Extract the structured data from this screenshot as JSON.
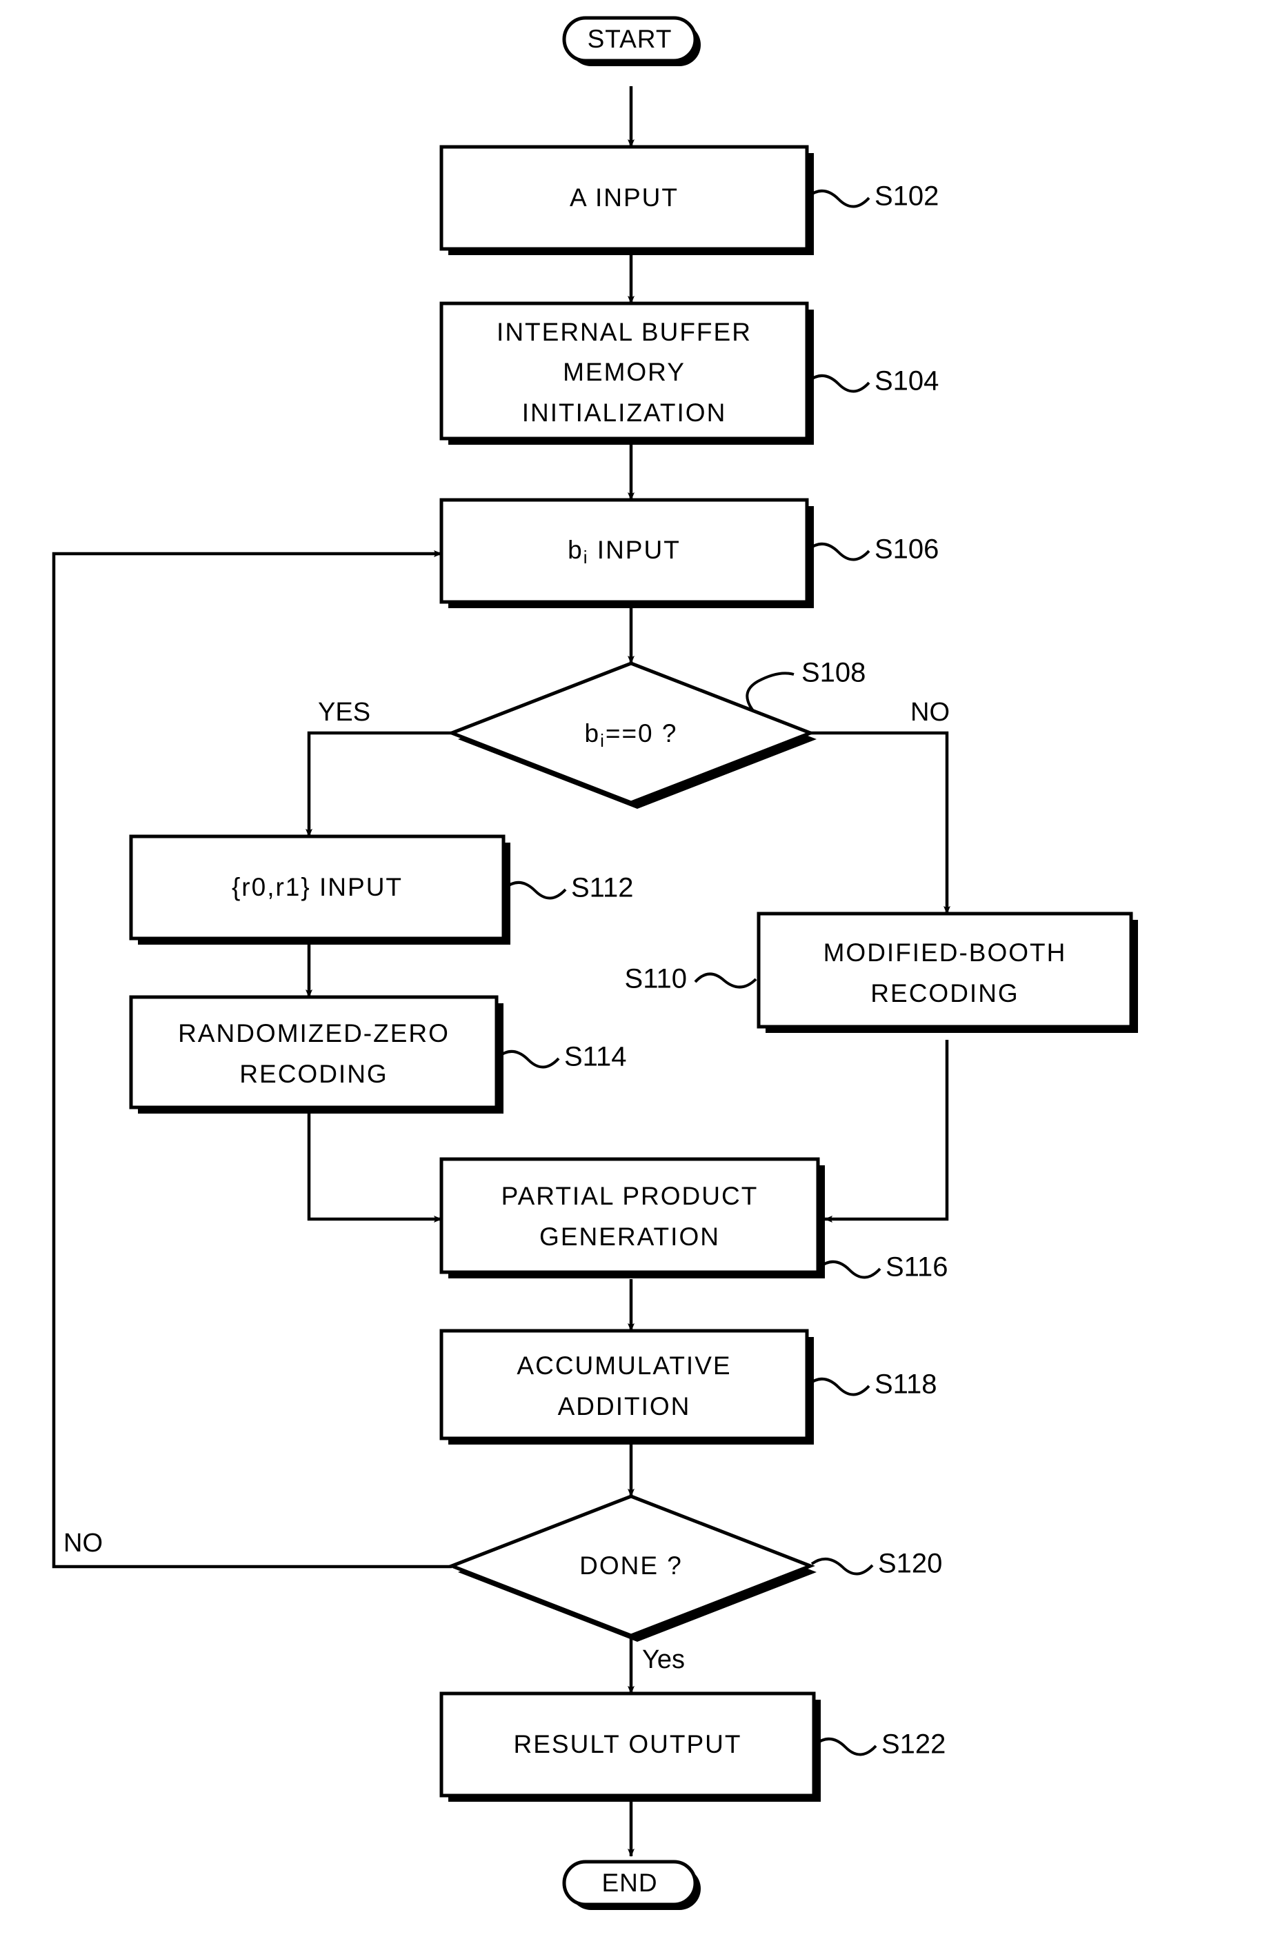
{
  "diagram": {
    "title": "Randomized-zero modified-booth multiplication flowchart",
    "terminators": {
      "start": "START",
      "end": "END"
    },
    "nodes": [
      {
        "id": "S102",
        "ref": "S102",
        "lines": [
          "A  INPUT"
        ],
        "shape": "process"
      },
      {
        "id": "S104",
        "ref": "S104",
        "lines": [
          "INTERNAL BUFFER",
          "MEMORY",
          "INITIALIZATION"
        ],
        "shape": "process"
      },
      {
        "id": "S106",
        "ref": "S106",
        "lines": [
          "bᵢ INPUT"
        ],
        "shape": "process"
      },
      {
        "id": "S108",
        "ref": "S108",
        "lines": [
          "bᵢ==0 ?"
        ],
        "shape": "decision"
      },
      {
        "id": "S110",
        "ref": "S110",
        "lines": [
          "MODIFIED-BOOTH",
          "RECODING"
        ],
        "shape": "process"
      },
      {
        "id": "S112",
        "ref": "S112",
        "lines": [
          "{r0,r1} INPUT"
        ],
        "shape": "process"
      },
      {
        "id": "S114",
        "ref": "S114",
        "lines": [
          "RANDOMIZED-ZERO",
          "RECODING"
        ],
        "shape": "process"
      },
      {
        "id": "S116",
        "ref": "S116",
        "lines": [
          "PARTIAL PRODUCT",
          "GENERATION"
        ],
        "shape": "process"
      },
      {
        "id": "S118",
        "ref": "S118",
        "lines": [
          "ACCUMULATIVE",
          "ADDITION"
        ],
        "shape": "process"
      },
      {
        "id": "S120",
        "ref": "S120",
        "lines": [
          "DONE ?"
        ],
        "shape": "decision"
      },
      {
        "id": "S122",
        "ref": "S122",
        "lines": [
          "RESULT OUTPUT"
        ],
        "shape": "process"
      }
    ],
    "edge_labels": {
      "s108_yes": "YES",
      "s108_no": "NO",
      "s120_no": "NO",
      "s120_yes": "Yes"
    },
    "refs": {
      "s102": "S102",
      "s104": "S104",
      "s106": "S106",
      "s108": "S108",
      "s110": "S110",
      "s112": "S112",
      "s114": "S114",
      "s116": "S116",
      "s118": "S118",
      "s120": "S120",
      "s122": "S122"
    },
    "text": {
      "s102_l1": "A  INPUT",
      "s104_l1": "INTERNAL BUFFER",
      "s104_l2": "MEMORY",
      "s104_l3": "INITIALIZATION",
      "s106_main": "b",
      "s106_sub": "i",
      "s106_tail": " INPUT",
      "s108_main": "b",
      "s108_sub": "i",
      "s108_tail": "==0 ?",
      "s110_l1": "MODIFIED-BOOTH",
      "s110_l2": "RECODING",
      "s112_l1": "{r0,r1} INPUT",
      "s114_l1": "RANDOMIZED-ZERO",
      "s114_l2": "RECODING",
      "s116_l1": "PARTIAL PRODUCT",
      "s116_l2": "GENERATION",
      "s118_l1": "ACCUMULATIVE",
      "s118_l2": "ADDITION",
      "s120_l1": "DONE ?",
      "s122_l1": "RESULT OUTPUT",
      "start": "START",
      "end": "END"
    },
    "colors": {
      "stroke": "#000000",
      "fill": "#ffffff",
      "shadow": "#000000",
      "background": "#ffffff"
    }
  }
}
